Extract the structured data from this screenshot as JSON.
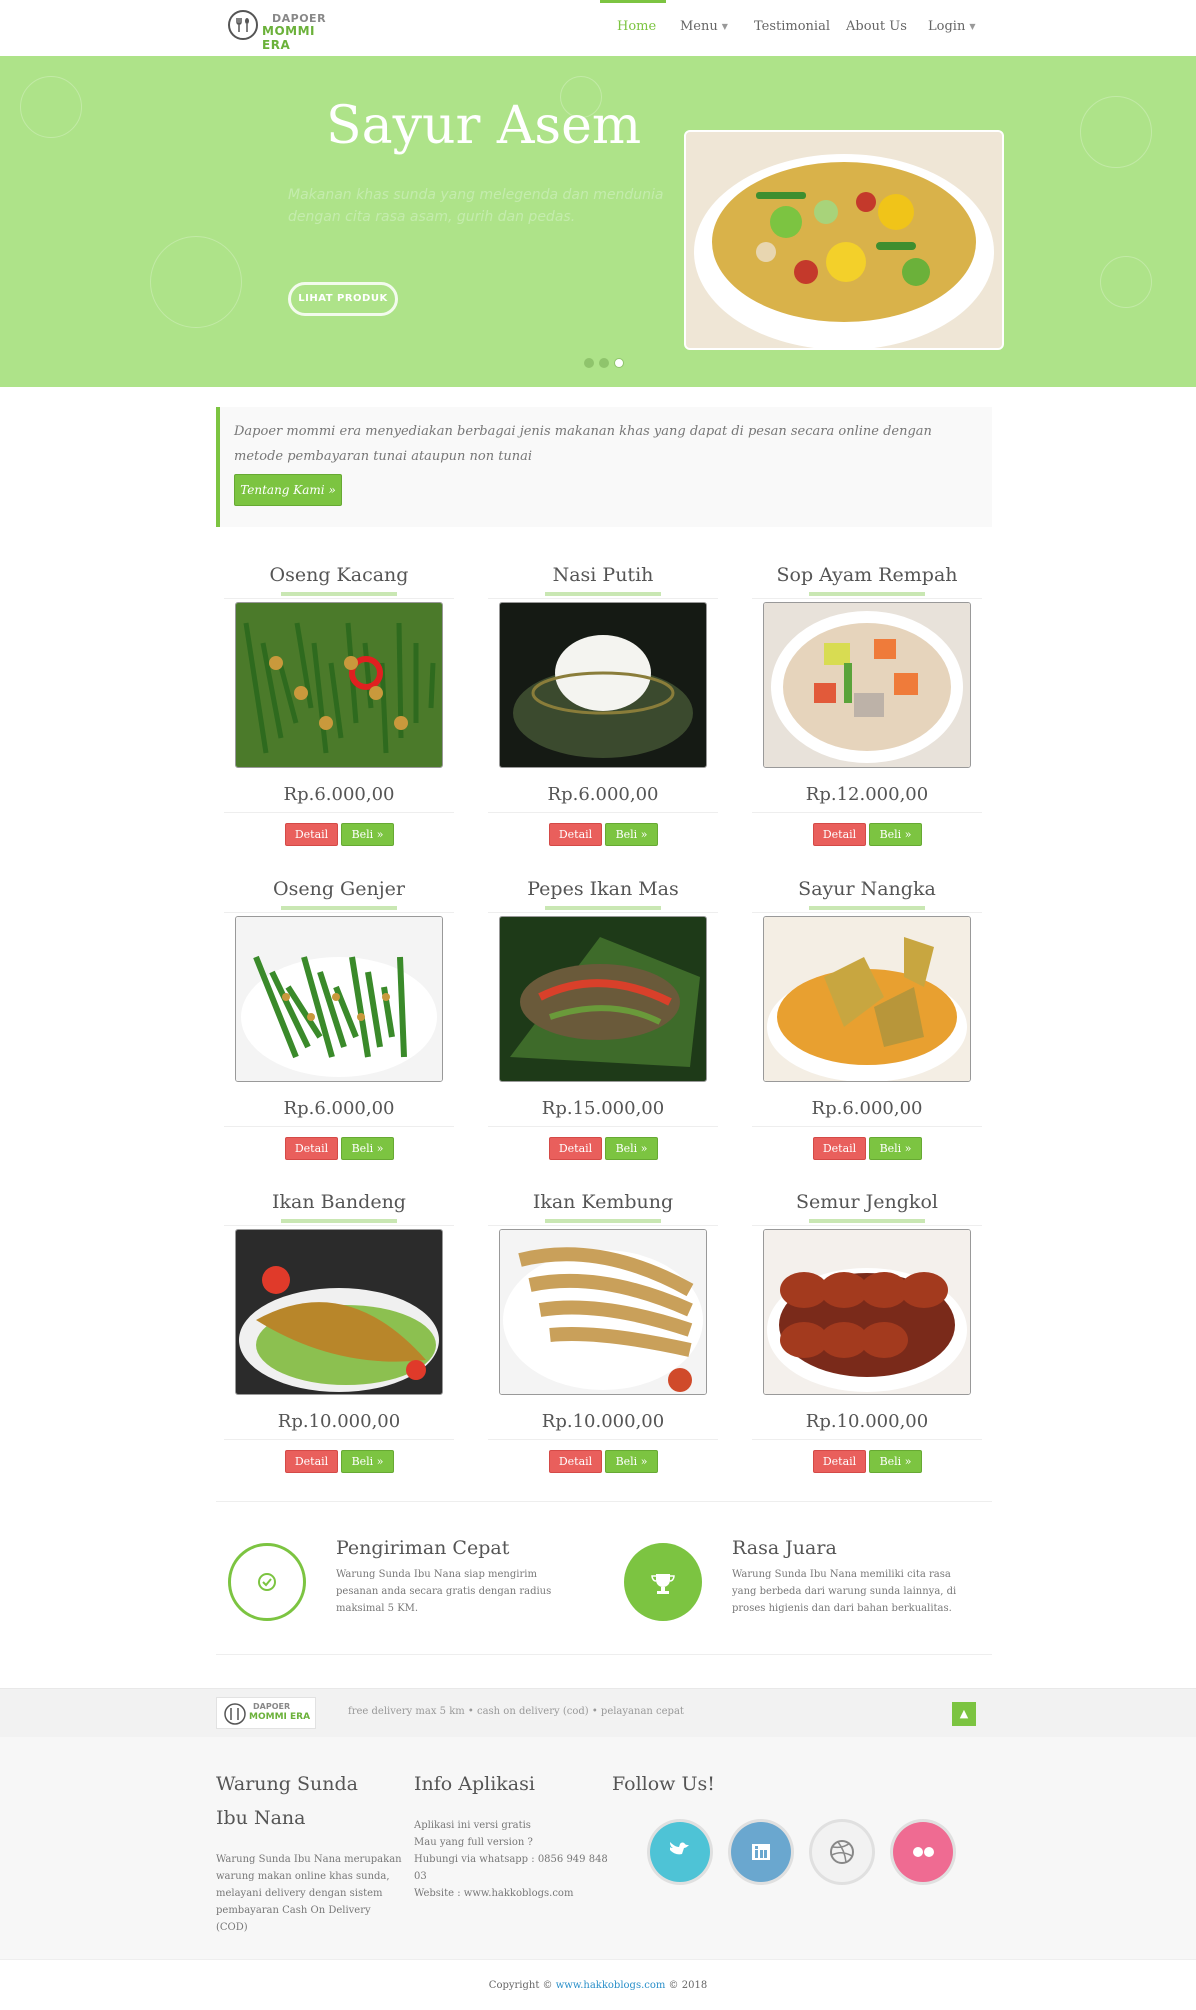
{
  "brand": {
    "line1": "DAPOER",
    "line2": "MOMMI ERA"
  },
  "nav": [
    {
      "label": "Home",
      "active": true
    },
    {
      "label": "Menu",
      "dropdown": true
    },
    {
      "label": "Testimonial"
    },
    {
      "label": "About Us"
    },
    {
      "label": "Login",
      "dropdown": true
    }
  ],
  "hero": {
    "title": "Sayur Asem",
    "subtitle": "Makanan khas sunda yang melegenda dan mendunia dengan cita rasa asam, gurih dan pedas.",
    "button": "LIHAT PRODUK",
    "slides_count": 3,
    "active_slide": 3
  },
  "intro": {
    "text": "Dapoer mommi era menyediakan berbagai jenis makanan khas yang dapat di pesan secara online dengan metode pembayaran tunai ataupun non tunai",
    "button": "Tentang Kami »"
  },
  "products": [
    {
      "name": "Oseng Kacang",
      "price": "Rp.6.000,00",
      "detail": "Detail",
      "buy": "Beli »"
    },
    {
      "name": "Nasi Putih",
      "price": "Rp.6.000,00",
      "detail": "Detail",
      "buy": "Beli »"
    },
    {
      "name": "Sop Ayam Rempah",
      "price": "Rp.12.000,00",
      "detail": "Detail",
      "buy": "Beli »"
    },
    {
      "name": "Oseng Genjer",
      "price": "Rp.6.000,00",
      "detail": "Detail",
      "buy": "Beli »"
    },
    {
      "name": "Pepes Ikan Mas",
      "price": "Rp.15.000,00",
      "detail": "Detail",
      "buy": "Beli »"
    },
    {
      "name": "Sayur Nangka",
      "price": "Rp.6.000,00",
      "detail": "Detail",
      "buy": "Beli »"
    },
    {
      "name": "Ikan Bandeng",
      "price": "Rp.10.000,00",
      "detail": "Detail",
      "buy": "Beli »"
    },
    {
      "name": "Ikan Kembung",
      "price": "Rp.10.000,00",
      "detail": "Detail",
      "buy": "Beli »"
    },
    {
      "name": "Semur Jengkol",
      "price": "Rp.10.000,00",
      "detail": "Detail",
      "buy": "Beli »"
    }
  ],
  "features": [
    {
      "title": "Pengiriman Cepat",
      "text": "Warung Sunda Ibu Nana siap mengirim pesanan anda secara gratis dengan radius maksimal 5 KM.",
      "icon": "check-icon"
    },
    {
      "title": "Rasa Juara",
      "text": "Warung Sunda Ibu Nana memiliki cita rasa yang berbeda dari warung sunda lainnya, di proses higienis dan dari bahan berkualitas.",
      "icon": "trophy-icon"
    }
  ],
  "strip": {
    "text": "free delivery max 5 km  •  cash on delivery (cod)  •  pelayanan cepat"
  },
  "footer": {
    "col1": {
      "title": "Warung Sunda Ibu Nana",
      "text": "Warung Sunda Ibu Nana merupakan warung makan online khas sunda, melayani delivery dengan sistem pembayaran Cash On Delivery (COD)"
    },
    "col2": {
      "title": "Info Aplikasi",
      "lines": [
        "Aplikasi ini versi gratis",
        "Mau yang full version ?",
        "Hubungi via whatsapp : 0856 949 848 03",
        "Website : www.hakkoblogs.com"
      ]
    },
    "col3": {
      "title": "Follow Us!"
    },
    "social": [
      {
        "icon": "twitter-icon",
        "color": "#4ec3d6"
      },
      {
        "icon": "linkedin-icon",
        "color": "#6aa7cf"
      },
      {
        "icon": "dribbble-icon",
        "color": "#f2f2f2"
      },
      {
        "icon": "flickr-icon",
        "color": "#ef6b92"
      }
    ]
  },
  "copyright": {
    "prefix": "Copyright © ",
    "link": "www.hakkoblogs.com",
    "suffix": " © 2018"
  },
  "colors": {
    "accent": "#7cc441",
    "hero_bg": "#aee389",
    "danger": "#e95f5c"
  }
}
